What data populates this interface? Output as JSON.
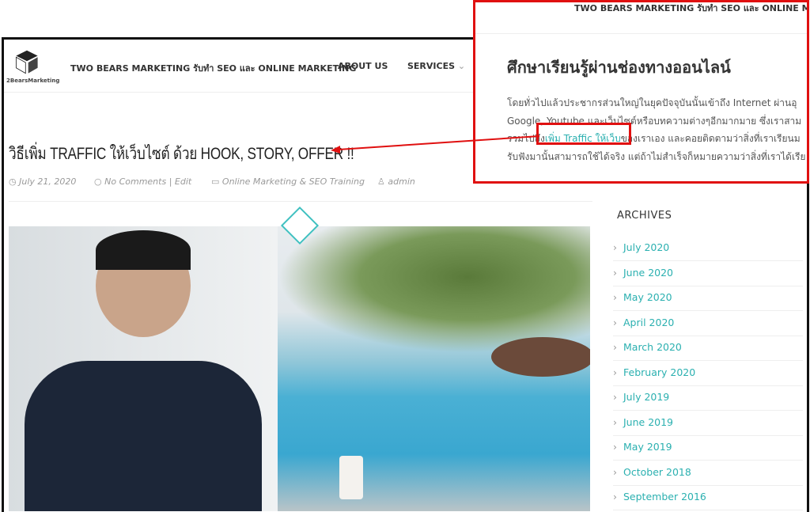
{
  "header": {
    "nav": [
      "TWO BEARS MARKETING รับทำ SEO และ ONLINE MARKETING",
      "ABOUT US",
      "SERVICES"
    ],
    "logo_text": "2BearsMarketing"
  },
  "post": {
    "title": "วิธีเพิ่ม TRAFFIC ให้เว็บไซต์ ด้วย HOOK, STORY, OFFER !!",
    "date": "July 21, 2020",
    "comments": "No Comments",
    "edit": "| Edit",
    "category": "Online Marketing & SEO Training",
    "author": "admin"
  },
  "sidebar": {
    "heading": "ARCHIVES",
    "items": [
      "July 2020",
      "June 2020",
      "May 2020",
      "April 2020",
      "March 2020",
      "February 2020",
      "July 2019",
      "June 2019",
      "May 2019",
      "October 2018",
      "September 2016"
    ]
  },
  "inset": {
    "nav": "TWO BEARS MARKETING รับทำ SEO และ ONLINE MARKETING",
    "heading": "ศึกษาเรียนรู้ผ่านช่องทางออนไลน์",
    "lines": [
      "โดยทั่วไปแล้วประชากรส่วนใหญ่ในยุคปัจจุบันนั้นเข้าถึง Internet ผ่านอุ",
      "Google, Youtube และเว็บไซต์หรือบทความต่างๆอีกมากมาย ซึ่งเราสาม",
      "รวมไปถึง",
      "ของเราเอง และคอยติดตามว่าสิ่งที่เราเรียนม",
      "รับฟังมานั้นสามารถใช้ได้จริง แต่ถ้าไม่สำเร็จก็หมายความว่าสิ่งที่เราได้เรีย"
    ],
    "link": "เพิ่ม Traffic ให้เว็บ"
  },
  "colors": {
    "accent": "#2bb0b0",
    "highlight": "#e01010"
  }
}
